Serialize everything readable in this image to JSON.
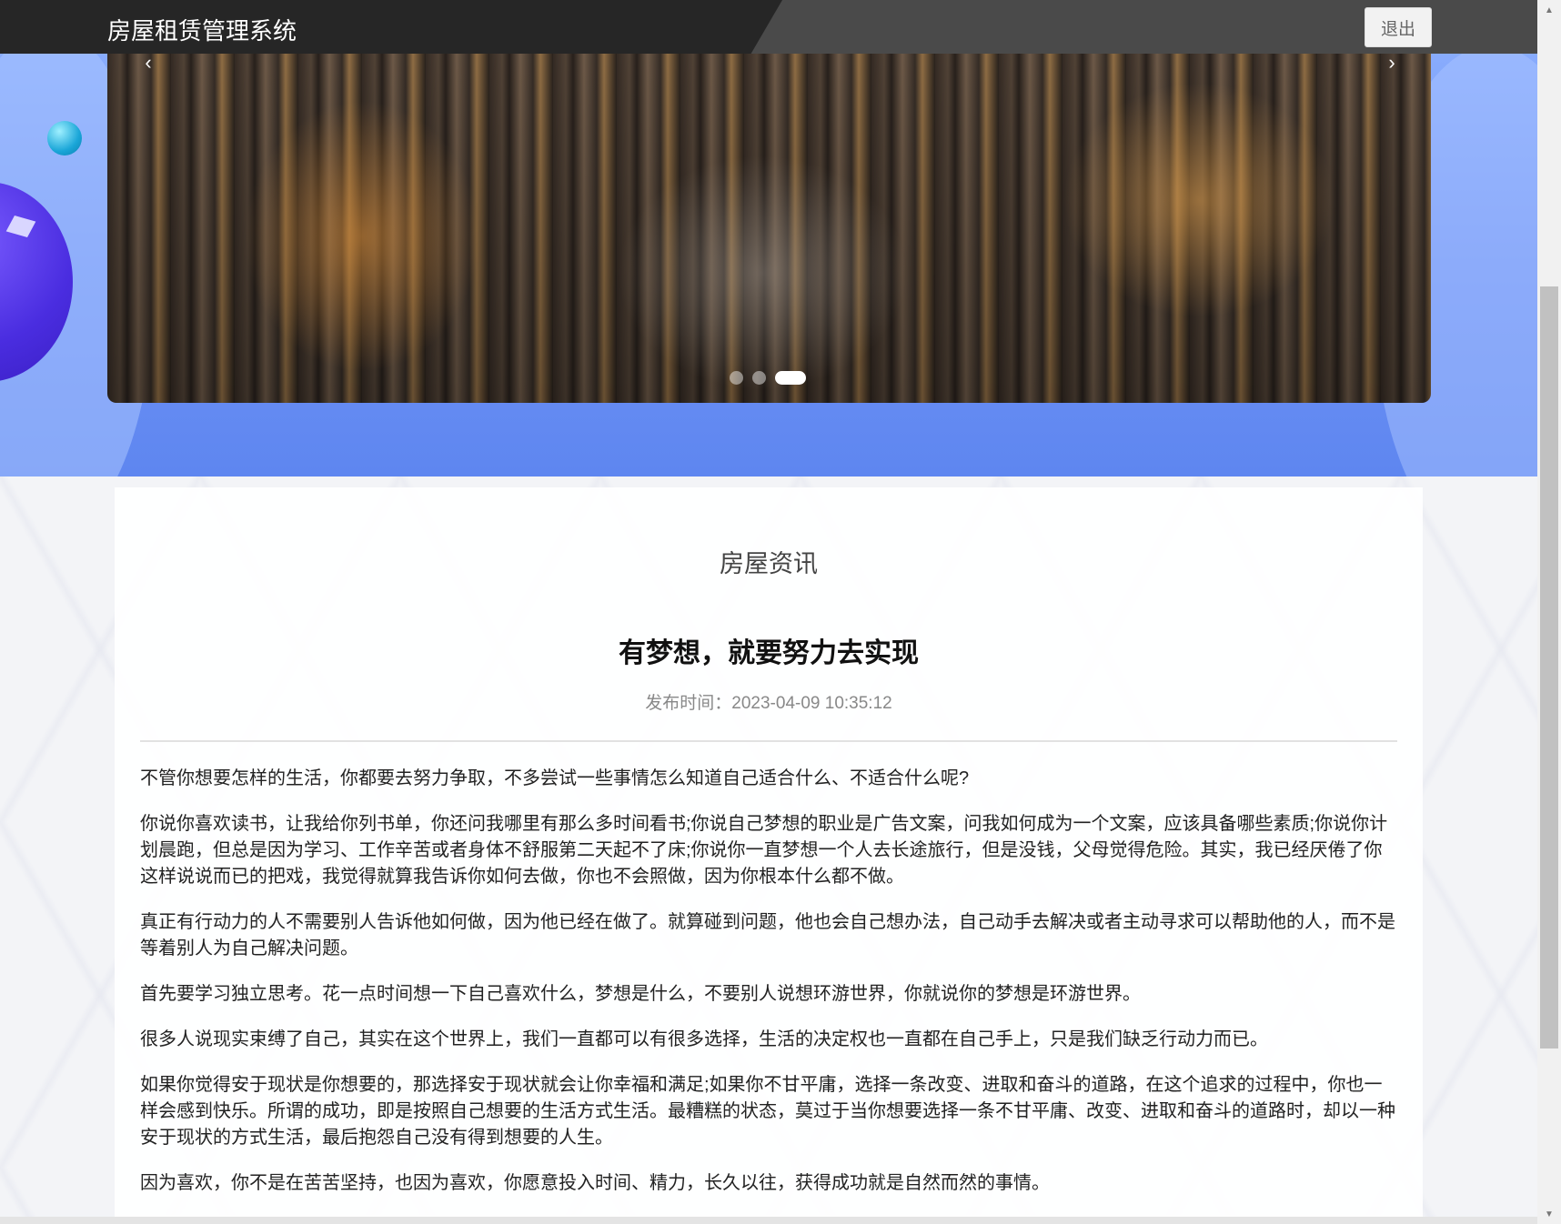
{
  "header": {
    "app_title": "房屋租赁管理系统",
    "logout_label": "退出"
  },
  "carousel": {
    "prev_arrow": "‹",
    "next_arrow": "›",
    "slide_count": 3,
    "active_index": 2
  },
  "article": {
    "section_title": "房屋资讯",
    "title": "有梦想，就要努力去实现",
    "publish_label": "发布时间：",
    "publish_time": "2023-04-09 10:35:12",
    "paragraphs": [
      "不管你想要怎样的生活，你都要去努力争取，不多尝试一些事情怎么知道自己适合什么、不适合什么呢?",
      "你说你喜欢读书，让我给你列书单，你还问我哪里有那么多时间看书;你说自己梦想的职业是广告文案，问我如何成为一个文案，应该具备哪些素质;你说你计划晨跑，但总是因为学习、工作辛苦或者身体不舒服第二天起不了床;你说你一直梦想一个人去长途旅行，但是没钱，父母觉得危险。其实，我已经厌倦了你这样说说而已的把戏，我觉得就算我告诉你如何去做，你也不会照做，因为你根本什么都不做。",
      "真正有行动力的人不需要别人告诉他如何做，因为他已经在做了。就算碰到问题，他也会自己想办法，自己动手去解决或者主动寻求可以帮助他的人，而不是等着别人为自己解决问题。",
      "首先要学习独立思考。花一点时间想一下自己喜欢什么，梦想是什么，不要别人说想环游世界，你就说你的梦想是环游世界。",
      "很多人说现实束缚了自己，其实在这个世界上，我们一直都可以有很多选择，生活的决定权也一直都在自己手上，只是我们缺乏行动力而已。",
      "如果你觉得安于现状是你想要的，那选择安于现状就会让你幸福和满足;如果你不甘平庸，选择一条改变、进取和奋斗的道路，在这个追求的过程中，你也一样会感到快乐。所谓的成功，即是按照自己想要的生活方式生活。最糟糕的状态，莫过于当你想要选择一条不甘平庸、改变、进取和奋斗的道路时，却以一种安于现状的方式生活，最后抱怨自己没有得到想要的人生。",
      "因为喜欢，你不是在苦苦坚持，也因为喜欢，你愿意投入时间、精力，长久以往，获得成功就是自然而然的事情。"
    ]
  },
  "colors": {
    "topbar_dark": "#262626",
    "topbar_light": "#4a4a4a",
    "hero_blue": "#6f93f5"
  }
}
